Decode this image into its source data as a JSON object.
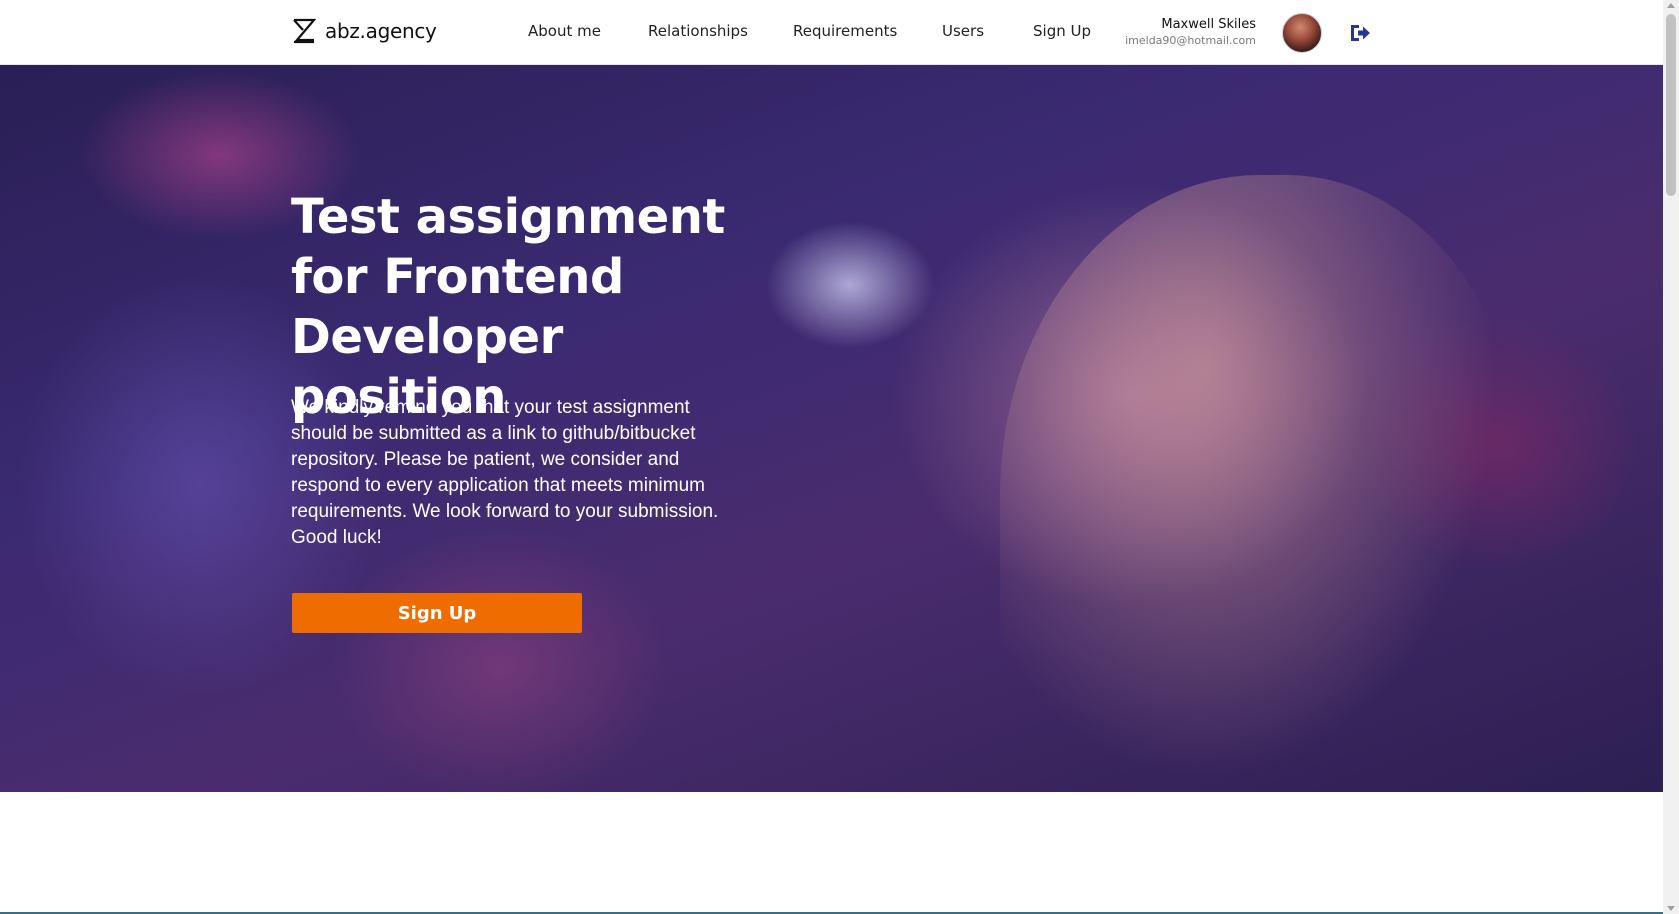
{
  "header": {
    "logo_text": "abz.agency",
    "nav": [
      {
        "label": "About me"
      },
      {
        "label": "Relationships"
      },
      {
        "label": "Requirements"
      },
      {
        "label": "Users"
      },
      {
        "label": "Sign Up"
      }
    ],
    "user": {
      "name": "Maxwell Skiles",
      "email": "imelda90@hotmail.com"
    },
    "icons": {
      "logo": "abz-logo-icon",
      "signout": "sign-out-icon",
      "avatar": "user-avatar"
    }
  },
  "hero": {
    "title": "Test assignment for Frontend Developer position",
    "text": "We kindly remind you that your test assignment should be submitted as a link to github/bitbucket repository.  Please be patient, we consider and respond to every application that meets minimum requirements. We look forward to your submission. Good luck!",
    "button_label": "Sign Up"
  },
  "colors": {
    "accent": "#ef6c00",
    "signout_icon": "#283593",
    "hero_overlay": "#3b2a72"
  }
}
